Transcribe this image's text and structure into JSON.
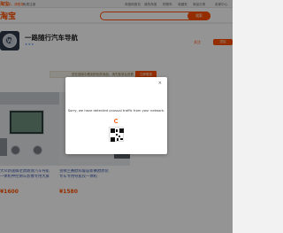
{
  "topbar": {
    "logo": "淘宝",
    "login": "亲，请登录",
    "free_register": "免费注册",
    "nav": [
      "淘宝网首页",
      "我的淘宝",
      "购物车",
      "收藏夹",
      "商品分类",
      "卖家中心"
    ]
  },
  "header": {
    "brand": "淘宝",
    "search_button": "搜索"
  },
  "shop": {
    "logo_letter": "W",
    "name": "一路随行汽车导航",
    "badge": "",
    "stars": "★★★",
    "follow_label": "关注",
    "enter_label": "进店"
  },
  "notice": {
    "text": "您在搜索中看到的相关商品，请先登录后查看",
    "button": "立即登录"
  },
  "products": [
    {
      "title_line1": "大众新速腾老款朗逸汽车导航",
      "title_line2": "一体机中控倒车影像专用大屏",
      "price": "¥1600"
    },
    {
      "title_line1": "雪佛兰赛欧科鲁兹新赛欧原装",
      "title_line2": "专车专用导航仪一体机",
      "price": "¥1580"
    }
  ],
  "footer_note": "",
  "modal": {
    "message": "Sorry, we have detected unusual traffic from your network.",
    "qr_caption": "",
    "close": "×"
  },
  "colors": {
    "accent": "#ff5000",
    "overlay": "rgba(0,0,0,0.42)"
  }
}
